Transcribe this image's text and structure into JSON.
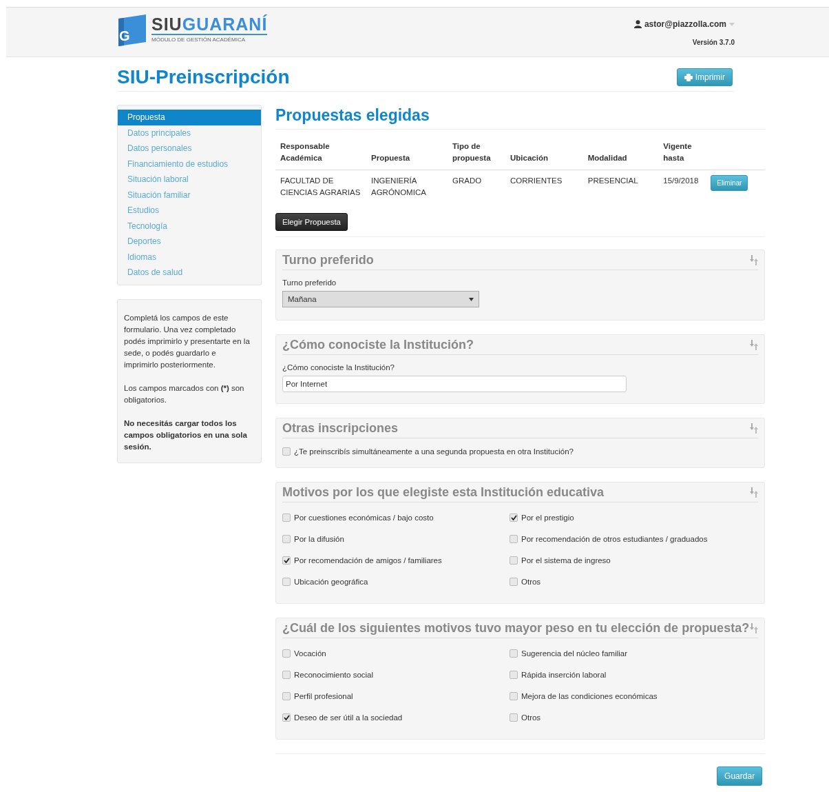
{
  "header": {
    "logo_letter": "G",
    "brand_a": "SIU",
    "brand_b": "GUARANÍ",
    "brand_subtitle": "MÓDULO DE GESTIÓN ACADÉMICA",
    "user": "astor@piazzolla.com",
    "version": "Versión 3.7.0"
  },
  "page_title": "SIU-Preinscripción",
  "print_button": "Imprimir",
  "sidebar": {
    "items": [
      {
        "label": "Propuesta",
        "selected": true
      },
      {
        "label": "Datos principales",
        "selected": false
      },
      {
        "label": "Datos personales",
        "selected": false
      },
      {
        "label": "Financiamiento de estudios",
        "selected": false
      },
      {
        "label": "Situación laboral",
        "selected": false
      },
      {
        "label": "Situación familiar",
        "selected": false
      },
      {
        "label": "Estudios",
        "selected": false
      },
      {
        "label": "Tecnología",
        "selected": false
      },
      {
        "label": "Deportes",
        "selected": false
      },
      {
        "label": "Idiomas",
        "selected": false
      },
      {
        "label": "Datos de salud",
        "selected": false
      }
    ]
  },
  "info": {
    "paragraphs": [
      {
        "text": "Completá los campos de este formulario. Una vez completado podés imprimirlo y presentarte en la sede, o podés guardarlo e imprimirlo posteriormente.",
        "bold": false
      },
      {
        "text": "Los campos marcados con **(*)** son obligatorios.",
        "bold": false
      },
      {
        "text": "No necesitás cargar todos los campos obligatorios en una sola sesión.",
        "bold": true
      }
    ]
  },
  "proposals": {
    "title": "Propuestas elegidas",
    "columns": [
      "Responsable Académica",
      "Propuesta",
      "Tipo de propuesta",
      "Ubicación",
      "Modalidad",
      "Vigente hasta"
    ],
    "rows": [
      {
        "cells": [
          "FACULTAD DE CIENCIAS AGRARIAS",
          "INGENIERÍA AGRÓNOMICA",
          "GRADO",
          "CORRIENTES",
          "PRESENCIAL",
          "15/9/2018"
        ],
        "action": "Eliminar"
      }
    ],
    "choose_button": "Elegir Propuesta"
  },
  "panels": [
    {
      "kind": "select",
      "title": "Turno preferido",
      "label": "Turno preferido",
      "value": "Mañana"
    },
    {
      "kind": "text",
      "title": "¿Cómo conociste la Institución?",
      "label": "¿Cómo conociste la Institución?",
      "value": "Por Internet"
    },
    {
      "kind": "checklist",
      "title": "Otras inscripciones",
      "options": [
        {
          "label": "¿Te preinscribís simultáneamente a una segunda propuesta en otra Institución?",
          "checked": false
        }
      ]
    },
    {
      "kind": "checkgrid",
      "title": "Motivos por los que elegiste esta Institución educativa",
      "options": [
        {
          "label": "Por cuestiones económicas / bajo costo",
          "checked": false
        },
        {
          "label": "Por el prestigio",
          "checked": true
        },
        {
          "label": "Por la difusión",
          "checked": false
        },
        {
          "label": "Por recomendación de otros estudiantes / graduados",
          "checked": false
        },
        {
          "label": "Por recomendación de amigos / familiares",
          "checked": true
        },
        {
          "label": "Por el sistema de ingreso",
          "checked": false
        },
        {
          "label": "Ubicación geográfica",
          "checked": false
        },
        {
          "label": "Otros",
          "checked": false
        }
      ]
    },
    {
      "kind": "checkgrid",
      "title": "¿Cuál de los siguientes motivos tuvo mayor peso en tu elección de propuesta?",
      "options": [
        {
          "label": "Vocación",
          "checked": false
        },
        {
          "label": "Sugerencia del núcleo familiar",
          "checked": false
        },
        {
          "label": "Reconocimiento social",
          "checked": false
        },
        {
          "label": "Rápida inserción laboral",
          "checked": false
        },
        {
          "label": "Perfil profesional",
          "checked": false
        },
        {
          "label": "Mejora de las condiciones económicas",
          "checked": false
        },
        {
          "label": "Deseo de ser útil a la sociedad",
          "checked": true
        },
        {
          "label": "Otros",
          "checked": false
        }
      ]
    }
  ],
  "save_button": "Guardar"
}
